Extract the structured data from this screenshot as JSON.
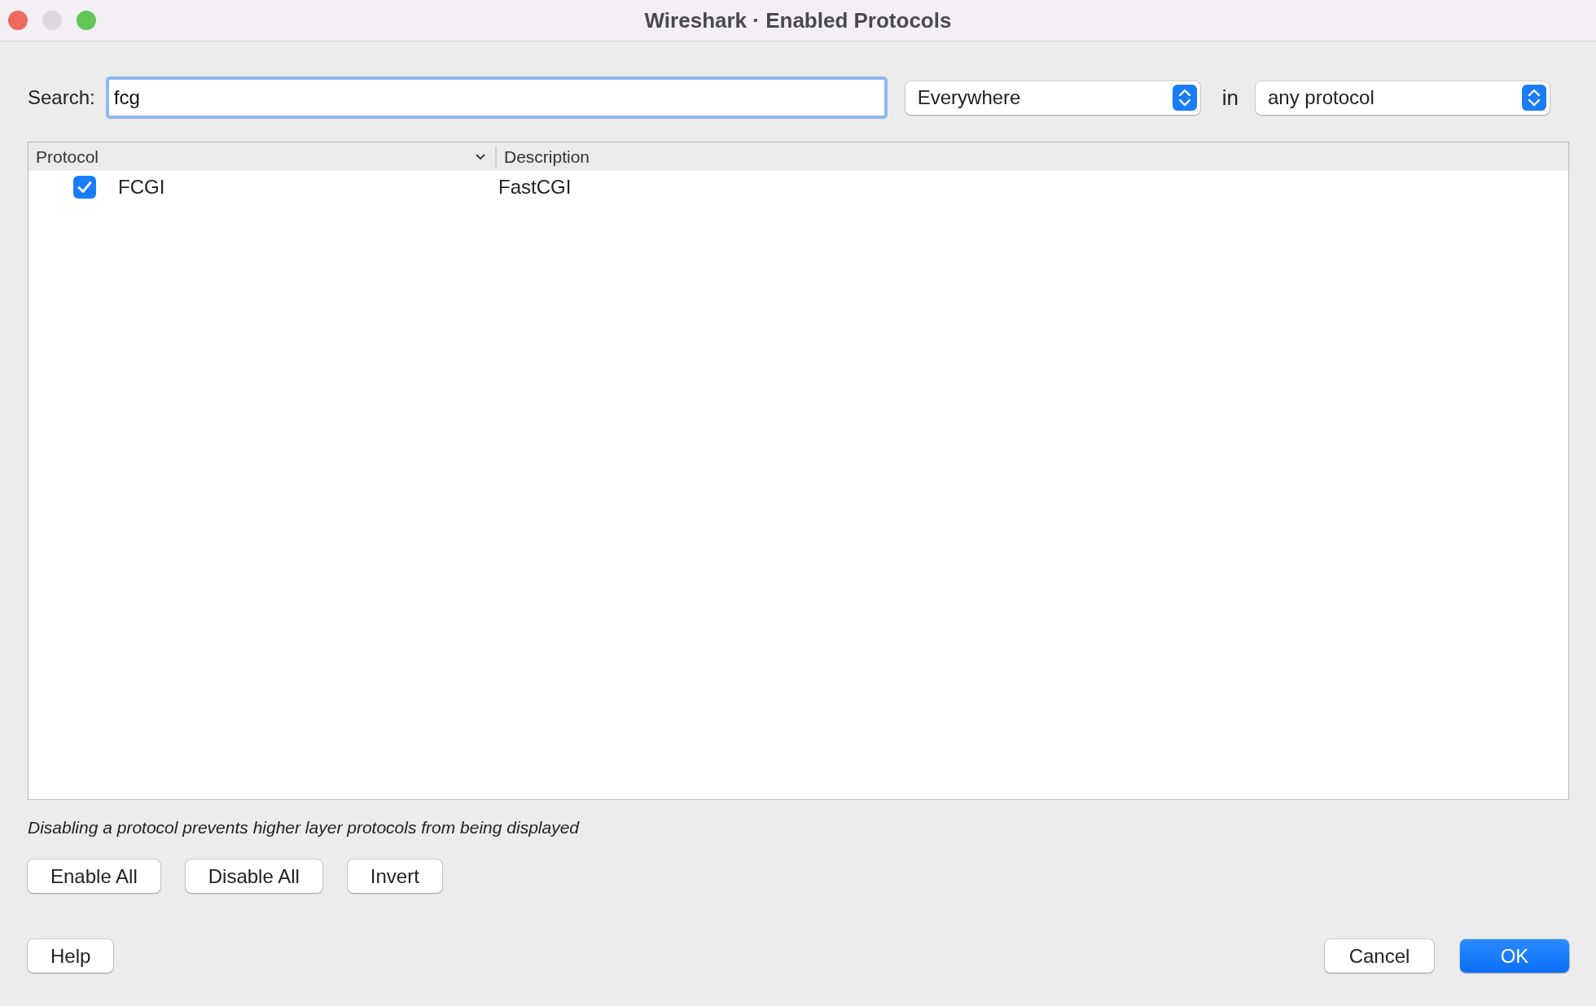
{
  "window": {
    "title": "Wireshark · Enabled Protocols"
  },
  "search": {
    "label": "Search:",
    "value": "fcg"
  },
  "match_dropdown": {
    "value": "Everywhere"
  },
  "scope_label": "in",
  "scope_dropdown": {
    "value": "any protocol"
  },
  "table": {
    "columns": [
      "Protocol",
      "Description"
    ],
    "rows": [
      {
        "protocol": "FCGI",
        "description": "FastCGI",
        "checked": true
      }
    ]
  },
  "hint": "Disabling a protocol prevents higher layer protocols from being displayed",
  "action_buttons": [
    "Enable All",
    "Disable All",
    "Invert"
  ],
  "help_button": "Help",
  "dialog_buttons": [
    {
      "label": "Cancel",
      "kind": "default"
    },
    {
      "label": "OK",
      "kind": "primary"
    }
  ]
}
